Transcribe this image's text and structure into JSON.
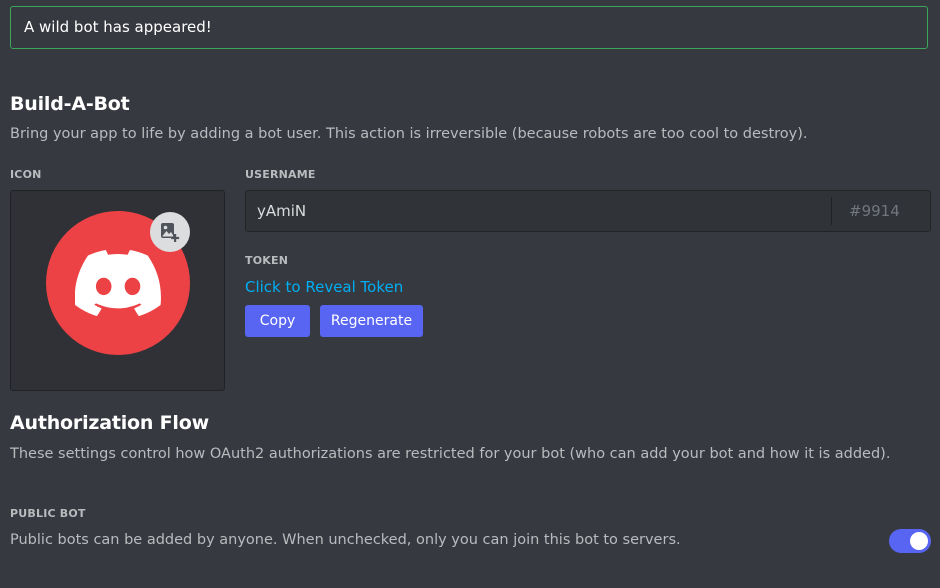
{
  "alert": {
    "text": "A wild bot has appeared!"
  },
  "build": {
    "title": "Build-A-Bot",
    "description": "Bring your app to life by adding a bot user. This action is irreversible (because robots are too cool to destroy).",
    "icon_label": "ICON",
    "username_label": "USERNAME",
    "username_value": "yAmiN",
    "discriminator": "#9914",
    "token_label": "TOKEN",
    "reveal_token": "Click to Reveal Token",
    "copy_button": "Copy",
    "regenerate_button": "Regenerate"
  },
  "auth": {
    "title": "Authorization Flow",
    "description": "These settings control how OAuth2 authorizations are restricted for your bot (who can add your bot and how it is added)."
  },
  "public_bot": {
    "label": "PUBLIC BOT",
    "description": "Public bots can be added by anyone. When unchecked, only you can join this bot to servers.",
    "enabled": true
  },
  "icons": {
    "avatar": "discord-logo-icon",
    "upload": "image-add-icon"
  },
  "colors": {
    "background": "#36393f",
    "accent": "#5865f2",
    "avatar": "#ed4245",
    "link": "#00aff4",
    "success_border": "#3ba55c"
  }
}
